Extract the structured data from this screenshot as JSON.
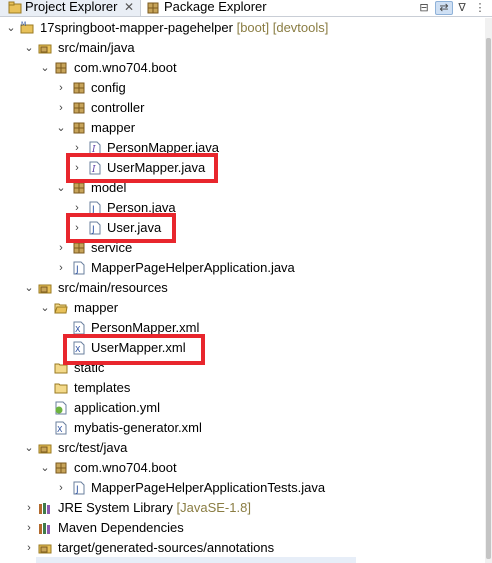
{
  "tabs": [
    {
      "label": "Project Explorer"
    },
    {
      "label": "Package Explorer"
    }
  ],
  "toolbar_icons": [
    "collapse-all-icon",
    "link-with-editor-icon",
    "filter-icon",
    "view-menu-icon"
  ],
  "tree": {
    "project": {
      "label": "17springboot-mapper-pagehelper",
      "decoration": "[boot] [devtools]"
    },
    "src_main_java": "src/main/java",
    "pkg_boot": "com.wno704.boot",
    "pkg_config": "config",
    "pkg_controller": "controller",
    "pkg_mapper": "mapper",
    "person_mapper_java": "PersonMapper.java",
    "user_mapper_java": "UserMapper.java",
    "pkg_model": "model",
    "person_java": "Person.java",
    "user_java": "User.java",
    "pkg_service": "service",
    "app_java": "MapperPageHelperApplication.java",
    "src_main_resources": "src/main/resources",
    "folder_mapper": "mapper",
    "person_mapper_xml": "PersonMapper.xml",
    "user_mapper_xml": "UserMapper.xml",
    "folder_static": "static",
    "folder_templates": "templates",
    "application_yml": "application.yml",
    "generator_xml": "mybatis-generator.xml",
    "src_test_java": "src/test/java",
    "test_pkg_boot": "com.wno704.boot",
    "test_java": "MapperPageHelperApplicationTests.java",
    "jre": {
      "label": "JRE System Library",
      "decoration": "[JavaSE-1.8]"
    },
    "maven": "Maven Dependencies",
    "generated": "target/generated-sources/annotations"
  },
  "colors": {
    "highlight": "#e8262d",
    "decoration": "#8a7d43",
    "selection": "#e7eef8"
  }
}
